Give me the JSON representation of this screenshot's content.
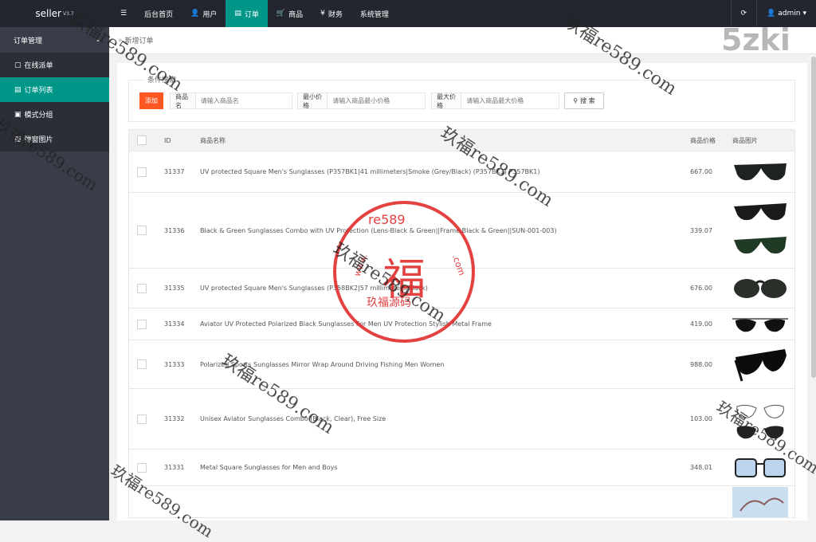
{
  "brand": {
    "name": "seller",
    "version": "V3.7"
  },
  "nav": {
    "items": [
      {
        "icon": "☰",
        "label": "",
        "name": "menu-toggle"
      },
      {
        "icon": "",
        "label": "后台首页",
        "name": "nav-home"
      },
      {
        "icon": "👤",
        "label": "用户",
        "name": "nav-user"
      },
      {
        "icon": "▤",
        "label": "订单",
        "name": "nav-order",
        "active": true
      },
      {
        "icon": "🛒",
        "label": "商品",
        "name": "nav-goods"
      },
      {
        "icon": "¥",
        "label": "财务",
        "name": "nav-finance"
      },
      {
        "icon": "",
        "label": "系统管理",
        "name": "nav-system"
      }
    ],
    "refresh_icon": "⟳",
    "user_icon": "👤",
    "user": "admin",
    "user_caret": "▾"
  },
  "sidebar": {
    "group": "订单管理",
    "items": [
      {
        "icon": "▢",
        "label": "在线派单"
      },
      {
        "icon": "▤",
        "label": "订单列表",
        "active": true
      },
      {
        "icon": "▣",
        "label": "模式分组"
      },
      {
        "icon": "▧",
        "label": "弹窗图片"
      }
    ]
  },
  "tab": {
    "arrow": "»",
    "label": "新增订单"
  },
  "search": {
    "legend": "条件搜索",
    "add_label": "添加",
    "fields": [
      {
        "label": "商品名",
        "placeholder": "请输入商品名"
      },
      {
        "label": "最小价格",
        "placeholder": "请输入商品最小价格"
      },
      {
        "label": "最大价格",
        "placeholder": "请输入商品最大价格"
      }
    ],
    "button_label": "搜 索"
  },
  "table": {
    "headers": {
      "id": "ID",
      "name": "商品名称",
      "price": "商品价格",
      "image": "商品图片"
    },
    "rows": [
      {
        "id": "31337",
        "name": "UV protected Square Men's Sunglasses (P357BK1|41 millimeters|Smoke (Grey/Black) (P357BK1) P357BK1)",
        "price": "667.00"
      },
      {
        "id": "31336",
        "name": "Black & Green Sunglasses Combo with UV Protection (Lens-Black & Green||Frame-Black & Green||SUN-001-003)",
        "price": "339.07"
      },
      {
        "id": "31335",
        "name": "UV protected Square Men's Sunglasses (P358BK2|57 millimeters|Black)",
        "price": "676.00"
      },
      {
        "id": "31334",
        "name": "Aviator UV Protected Polarized Black Sunglasses For Men UV Protection Stylish Metal Frame",
        "price": "419.00"
      },
      {
        "id": "31333",
        "name": "Polarized Sports Sunglasses Mirror Wrap Around Driving Fishing Men Women",
        "price": "988.00"
      },
      {
        "id": "31332",
        "name": "Unisex Aviator Sunglasses Combo (Black, Clear), Free Size",
        "price": "103.00"
      },
      {
        "id": "31331",
        "name": "Metal Square Sunglasses for Men and Boys",
        "price": "348.01"
      }
    ]
  },
  "watermark": {
    "site": "5zki",
    "stamp_top": "re589",
    "stamp_center": "福",
    "stamp_bottom": "玖福源码",
    "stamp_left": "www.",
    "stamp_right": ".com",
    "diag": "玖福re589.com"
  }
}
